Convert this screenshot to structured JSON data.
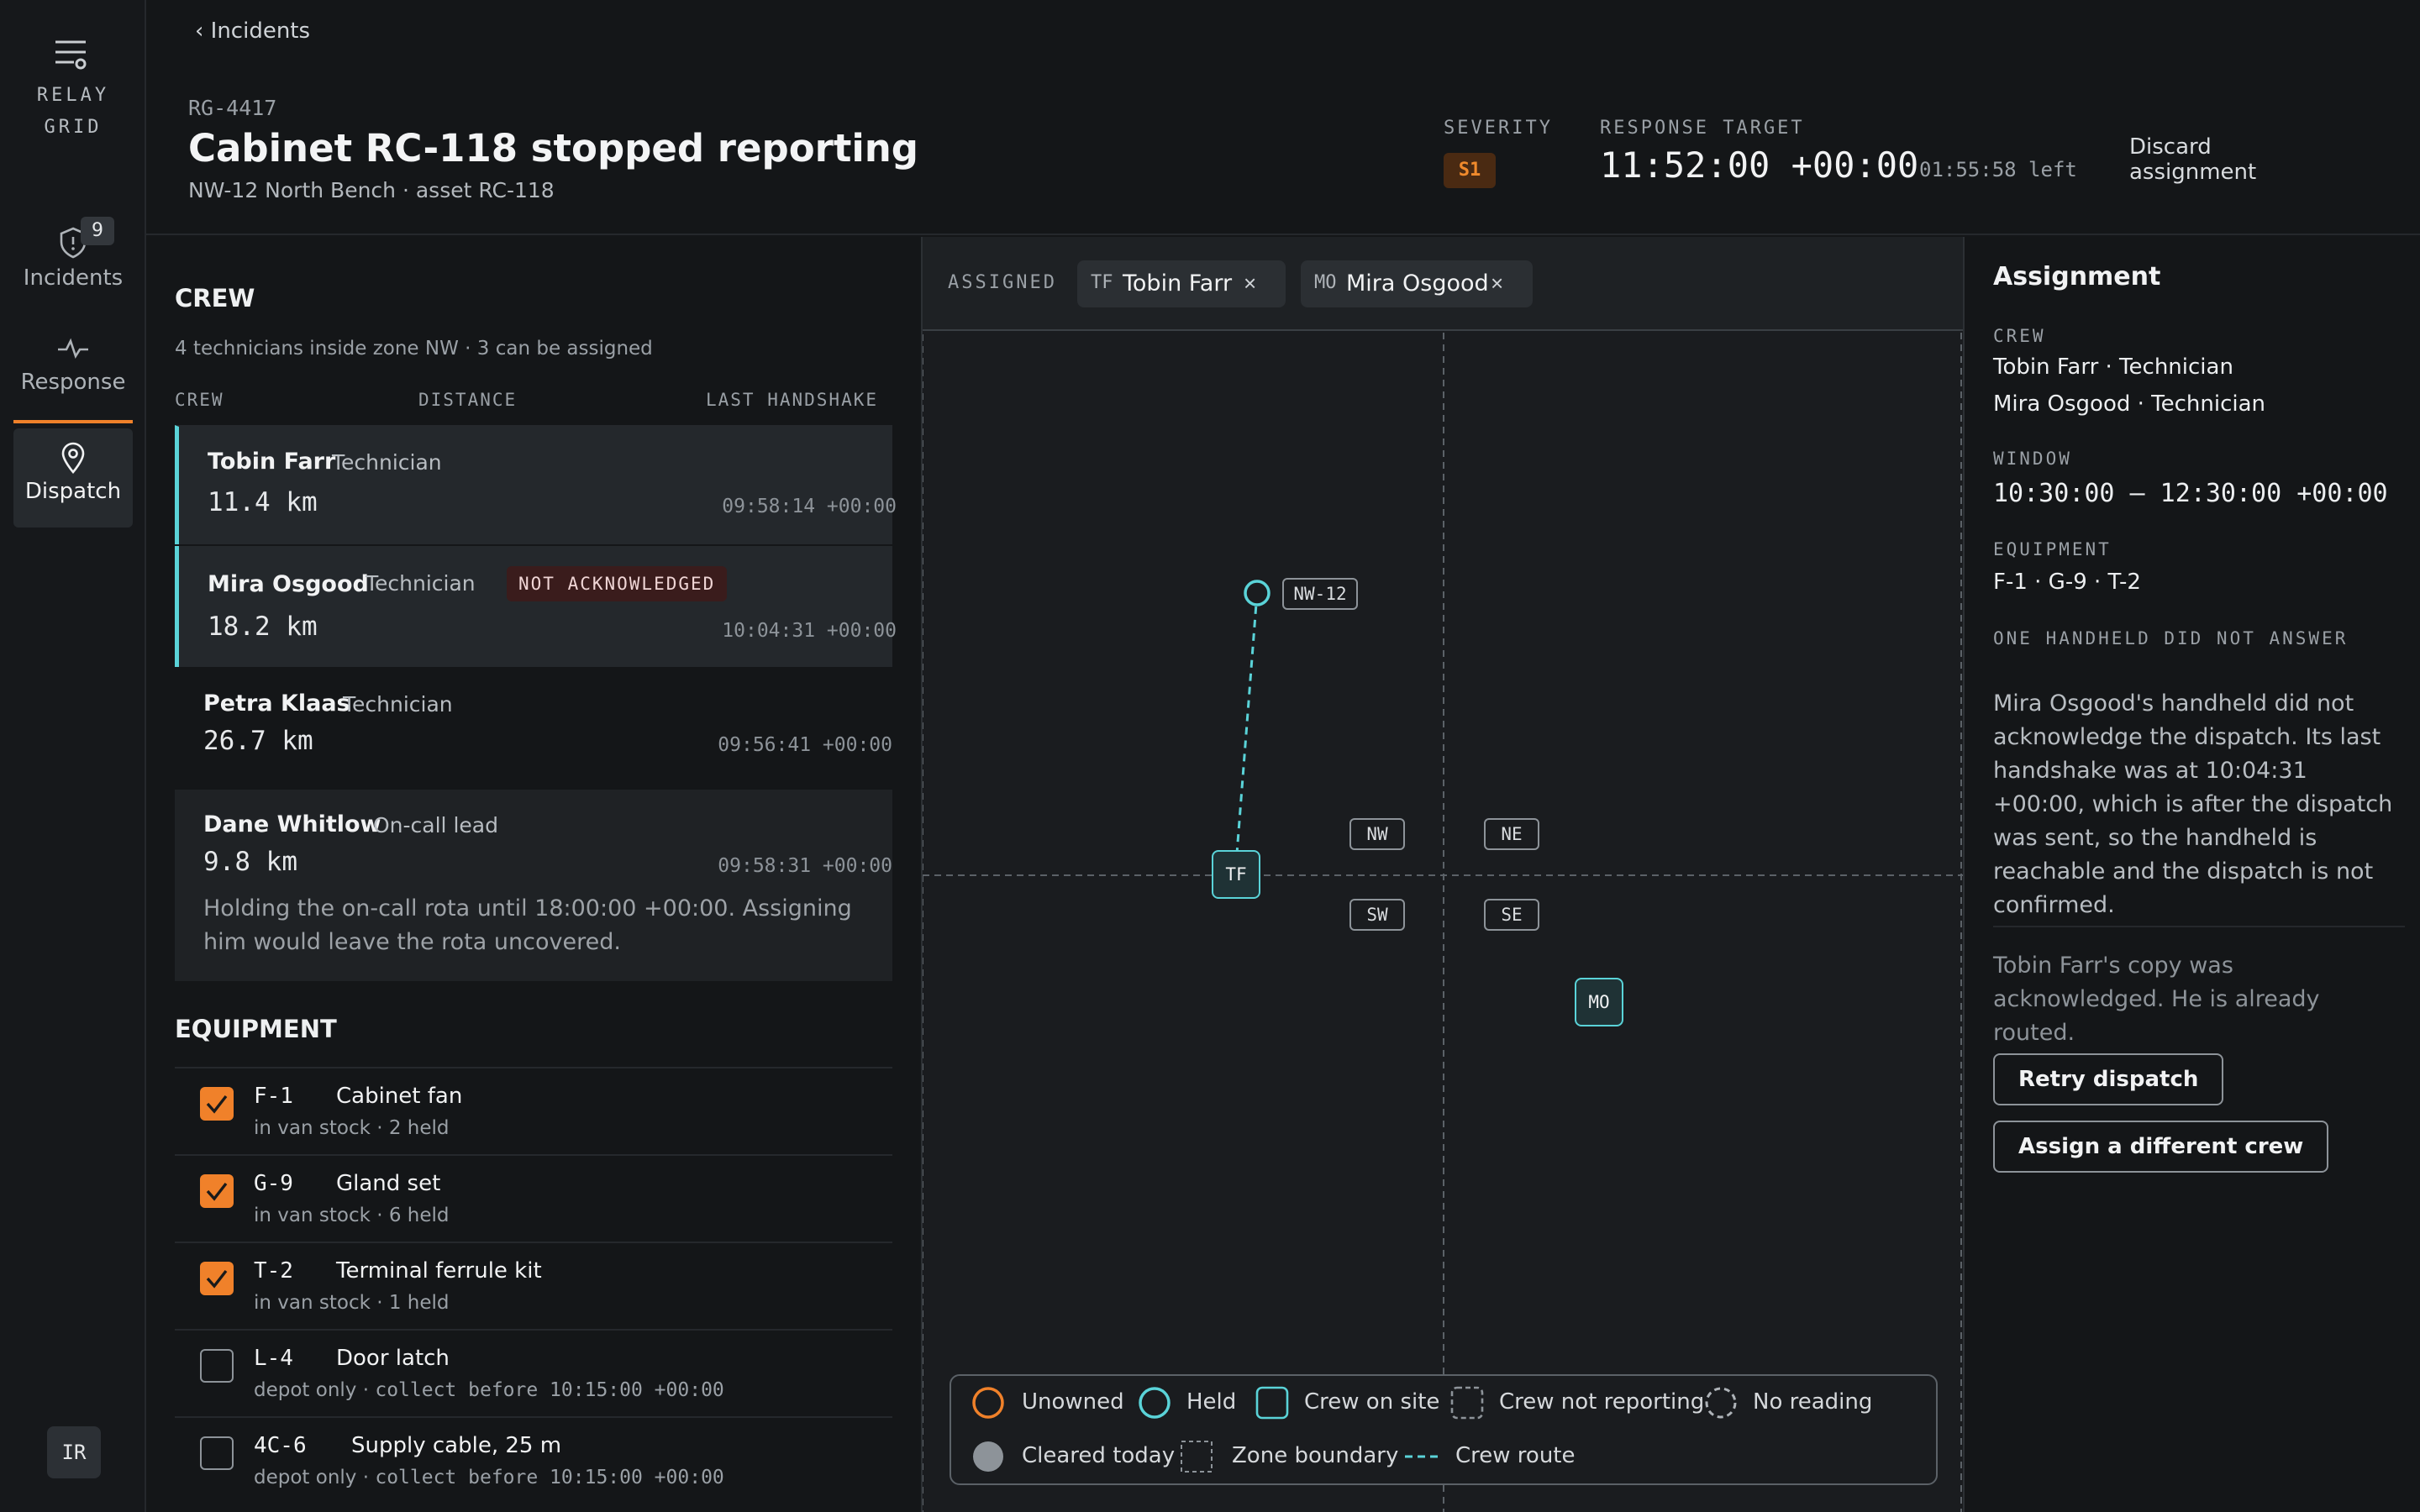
{
  "rail": {
    "brand_line1": "RELAY",
    "brand_line2": "GRID",
    "incidents_count": "9",
    "items": [
      {
        "label": "Incidents",
        "icon": "shield-alert-icon"
      },
      {
        "label": "Response",
        "icon": "pulse-icon"
      },
      {
        "label": "Dispatch",
        "icon": "map-pin-icon"
      }
    ],
    "active": "Dispatch",
    "avatar": "IR"
  },
  "header": {
    "back_label": "‹ Incidents",
    "incident_id": "RG-4417",
    "title": "Cabinet RC-118 stopped reporting",
    "subtitle": "NW-12 North Bench · asset RC-118",
    "severity_label": "SEVERITY",
    "severity": "S1",
    "target_label": "RESPONSE TARGET",
    "target_time": "11:52:00 +00:00",
    "time_left": "01:55:58 left",
    "discard": "Discard assignment"
  },
  "crew": {
    "heading": "CREW",
    "hint": "4 technicians inside zone NW · 3 can be assigned",
    "columns": [
      "CREW",
      "DISTANCE",
      "LAST HANDSHAKE"
    ],
    "rows": [
      {
        "name": "Tobin Farr",
        "role": "Technician",
        "distance": "11.4 km",
        "handshake": "09:58:14 +00:00",
        "selected": true
      },
      {
        "name": "Mira Osgood",
        "role": "Technician",
        "tag": "NOT ACKNOWLEDGED",
        "distance": "18.2 km",
        "handshake": "10:04:31 +00:00",
        "selected": true
      },
      {
        "name": "Petra Klaas",
        "role": "Technician",
        "distance": "26.7 km",
        "handshake": "09:56:41 +00:00",
        "selected": false
      },
      {
        "name": "Dane Whitlow",
        "role": "On-call lead",
        "distance": "9.8 km",
        "handshake": "09:58:31 +00:00",
        "note": "Holding the on-call rota until 18:00:00 +00:00. Assigning him would leave the rota uncovered.",
        "selected": false
      }
    ]
  },
  "equipment": {
    "heading": "EQUIPMENT",
    "items": [
      {
        "code": "F-1",
        "name": "Cabinet fan",
        "sub": "in van stock · 2 held",
        "checked": true
      },
      {
        "code": "G-9",
        "name": "Gland set",
        "sub": "in van stock · 6 held",
        "checked": true
      },
      {
        "code": "T-2",
        "name": "Terminal ferrule kit",
        "sub": "in van stock · 1 held",
        "checked": true
      },
      {
        "code": "L-4",
        "name": "Door latch",
        "sub_a": "depot only · ",
        "sub_b": "collect before 10:15:00 +00:00",
        "checked": false
      },
      {
        "code": "4C-6",
        "name": "Supply cable, 25 m",
        "sub_a": "depot only · ",
        "sub_b": "collect before 10:15:00 +00:00",
        "checked": false
      }
    ]
  },
  "map": {
    "assigned_label": "ASSIGNED",
    "chips": [
      {
        "initials": "TF",
        "name": "Tobin Farr",
        "remove": "×"
      },
      {
        "initials": "MO",
        "name": "Mira Osgood",
        "remove": "×"
      }
    ],
    "site_label": "NW-12",
    "zones": [
      "NW",
      "NE",
      "SW",
      "SE"
    ],
    "crew_markers": [
      "TF",
      "MO"
    ],
    "legend": [
      "Unowned",
      "Held",
      "Crew on site",
      "Crew not reporting",
      "No reading",
      "Cleared today",
      "Zone boundary",
      "Crew route"
    ],
    "colors": {
      "held": "#5ad3d8",
      "unowned": "#f0812a",
      "cleared": "#8d9399"
    }
  },
  "assignment": {
    "heading": "Assignment",
    "crew_label": "CREW",
    "crew": [
      "Tobin Farr · Technician",
      "Mira Osgood · Technician"
    ],
    "window_label": "WINDOW",
    "window": "10:30:00 – 12:30:00 +00:00",
    "equipment_label": "EQUIPMENT",
    "equipment": "F-1 · G-9 · T-2",
    "warning_label": "ONE HANDHELD DID NOT ANSWER",
    "warning_text": "Mira Osgood's handheld did not acknowledge the dispatch. Its last handshake was at 10:04:31 +00:00, which is after the dispatch was sent, so the handheld is reachable and the dispatch is not confirmed.",
    "ack_text": "Tobin Farr's copy was acknowledged. He is already routed.",
    "retry": "Retry dispatch",
    "reassign": "Assign a different crew"
  }
}
